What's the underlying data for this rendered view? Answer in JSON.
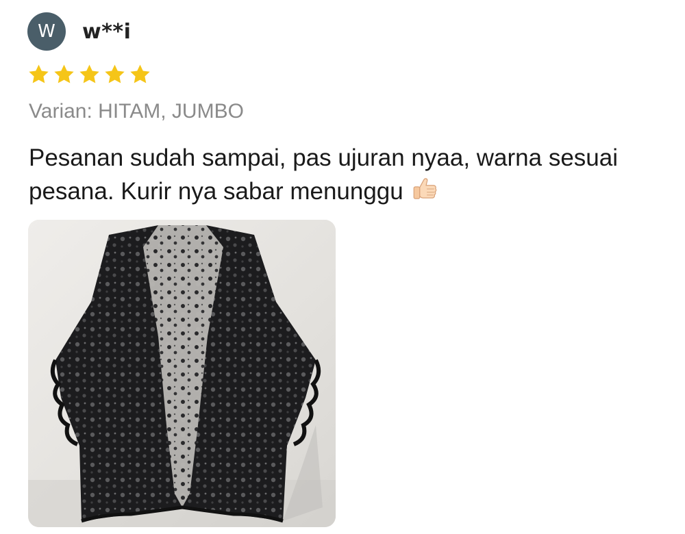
{
  "review": {
    "avatar_initial": "W",
    "username": "w**i",
    "rating": 5,
    "rating_max": 5,
    "variant": "Varian: HITAM, JUMBO",
    "comment": "Pesanan sudah sampai, pas ujuran nyaa, warna sesuai pesana. Kurir nya sabar menunggu",
    "comment_emoji": "thumbs-up-icon",
    "photo_subject": "black-lace-cardigan-photo"
  },
  "colors": {
    "avatar_bg": "#4a5e69",
    "star": "#f5c518",
    "variant_text": "#8a8a8a",
    "photo_bg": "#e7e5e1"
  }
}
